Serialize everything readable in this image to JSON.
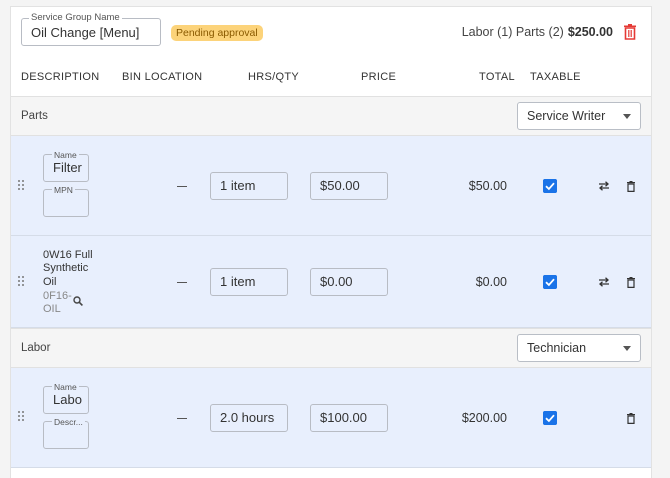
{
  "header": {
    "service_group_legend": "Service Group Name",
    "service_group_value": "Oil Change [Menu]",
    "badge": "Pending approval",
    "summary_counts": "Labor (1) Parts (2)",
    "summary_total": "$250.00"
  },
  "columns": {
    "description": "DESCRIPTION",
    "bin_location": "BIN LOCATION",
    "hrs_qty": "HRS/QTY",
    "price": "PRICE",
    "total": "TOTAL",
    "taxable": "TAXABLE"
  },
  "parts": {
    "label": "Parts",
    "assignee": "Service Writer",
    "rows": [
      {
        "name_legend": "Name",
        "name_value": "Filter",
        "mpn_legend": "MPN",
        "mpn_value": "",
        "bin": "—",
        "qty": "1 item",
        "price": "$50.00",
        "total": "$50.00",
        "taxable": true
      },
      {
        "name_l1": "0W16 Full",
        "name_l2": "Synthetic",
        "name_l3": "Oil",
        "mpn_l1": "0F16-",
        "mpn_l2": "OIL",
        "bin": "—",
        "qty": "1 item",
        "price": "$0.00",
        "total": "$0.00",
        "taxable": true
      }
    ]
  },
  "labor": {
    "label": "Labor",
    "assignee": "Technician",
    "rows": [
      {
        "name_legend": "Name",
        "name_value": "Labo",
        "desc_legend": "Descr...",
        "desc_value": "",
        "bin": "—",
        "hours": "2.0 hours",
        "price": "$100.00",
        "total": "$200.00",
        "taxable": true
      }
    ]
  },
  "colors": {
    "accent": "#1a73e8",
    "row_bg": "#e8effd",
    "badge_bg": "#fcd37a",
    "delete_red": "#e53935"
  },
  "icons": [
    "drag-handle-icon",
    "swap-icon",
    "trash-icon",
    "search-icon",
    "chevron-down-icon",
    "checkbox-checked-icon"
  ]
}
